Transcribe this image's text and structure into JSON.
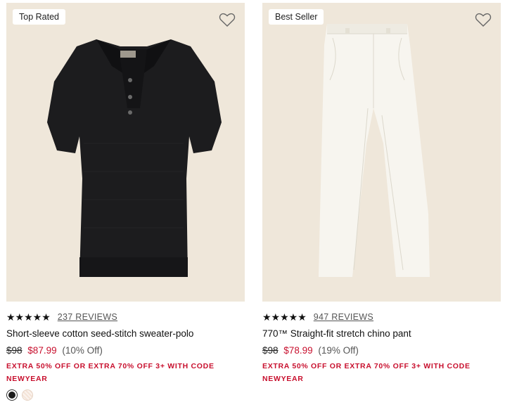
{
  "products": [
    {
      "badge": "Top Rated",
      "image_icon": "black-knit-polo",
      "stars": "★★★★★",
      "reviews": "237 REVIEWS",
      "title": "Short-sleeve cotton seed-stitch sweater-polo",
      "price_original": "$98",
      "price_sale": "$87.99",
      "price_off": "(10% Off)",
      "promo": "EXTRA 50% OFF OR EXTRA 70% OFF 3+ WITH CODE",
      "promo_code": "NEWYEAR",
      "swatch_colors": [
        "#1b1b1b",
        "#f4e4d8"
      ]
    },
    {
      "badge": "Best Seller",
      "image_icon": "white-chino-pant",
      "stars": "★★★★★",
      "reviews": "947 REVIEWS",
      "title": "770™ Straight-fit stretch chino pant",
      "price_original": "$98",
      "price_sale": "$78.99",
      "price_off": "(19% Off)",
      "promo": "EXTRA 50% OFF OR EXTRA 70% OFF 3+ WITH CODE",
      "promo_code": "NEWYEAR"
    }
  ],
  "colors": {
    "image_bg": "#efe7da",
    "sale_red": "#c8102e"
  }
}
